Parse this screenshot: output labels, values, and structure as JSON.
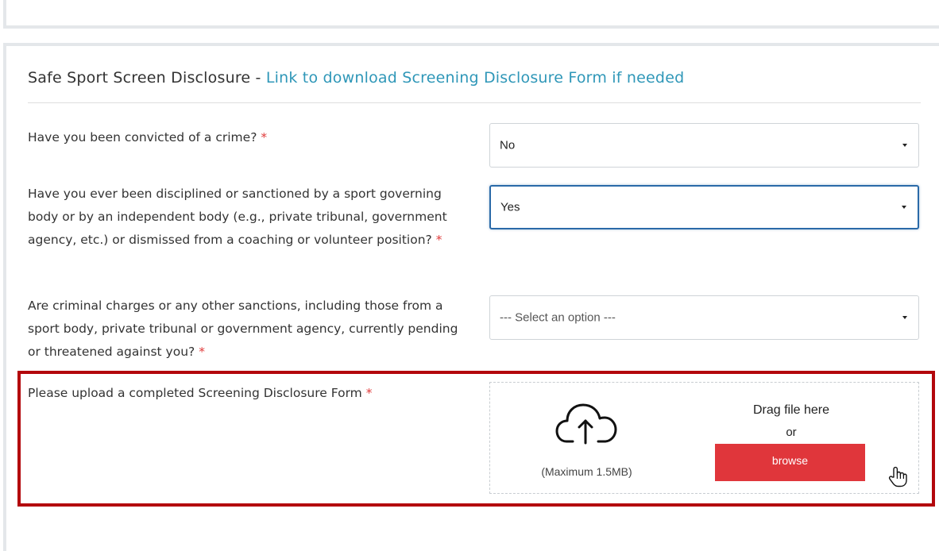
{
  "section": {
    "title": "Safe Sport Screen Disclosure - ",
    "link_text": "Link to download Screening Disclosure Form if needed"
  },
  "required_marker": "*",
  "questions": [
    {
      "label": "Have you been convicted of a crime?",
      "value": "No",
      "focused": false,
      "placeholder": false
    },
    {
      "label": "Have you ever been disciplined or sanctioned by a sport governing body or by an independent body (e.g., private tribunal, government agency, etc.) or dismissed from a coaching or volunteer position?",
      "value": "Yes",
      "focused": true,
      "placeholder": false
    },
    {
      "label": "Are criminal charges or any other sanctions, including those from a sport body, private tribunal or government agency, currently pending or threatened against you?",
      "value": "--- Select an option ---",
      "focused": false,
      "placeholder": true
    }
  ],
  "upload": {
    "label": "Please upload a completed Screening Disclosure Form",
    "drag_text": "Drag file here",
    "or_text": "or",
    "browse_label": "browse",
    "max_size": "(Maximum 1.5MB)",
    "upload_icon": "cloud-upload-icon",
    "button_color": "#e0363b"
  },
  "highlight_color": "#b3070c",
  "cursor_icon": "hand-pointer-icon"
}
